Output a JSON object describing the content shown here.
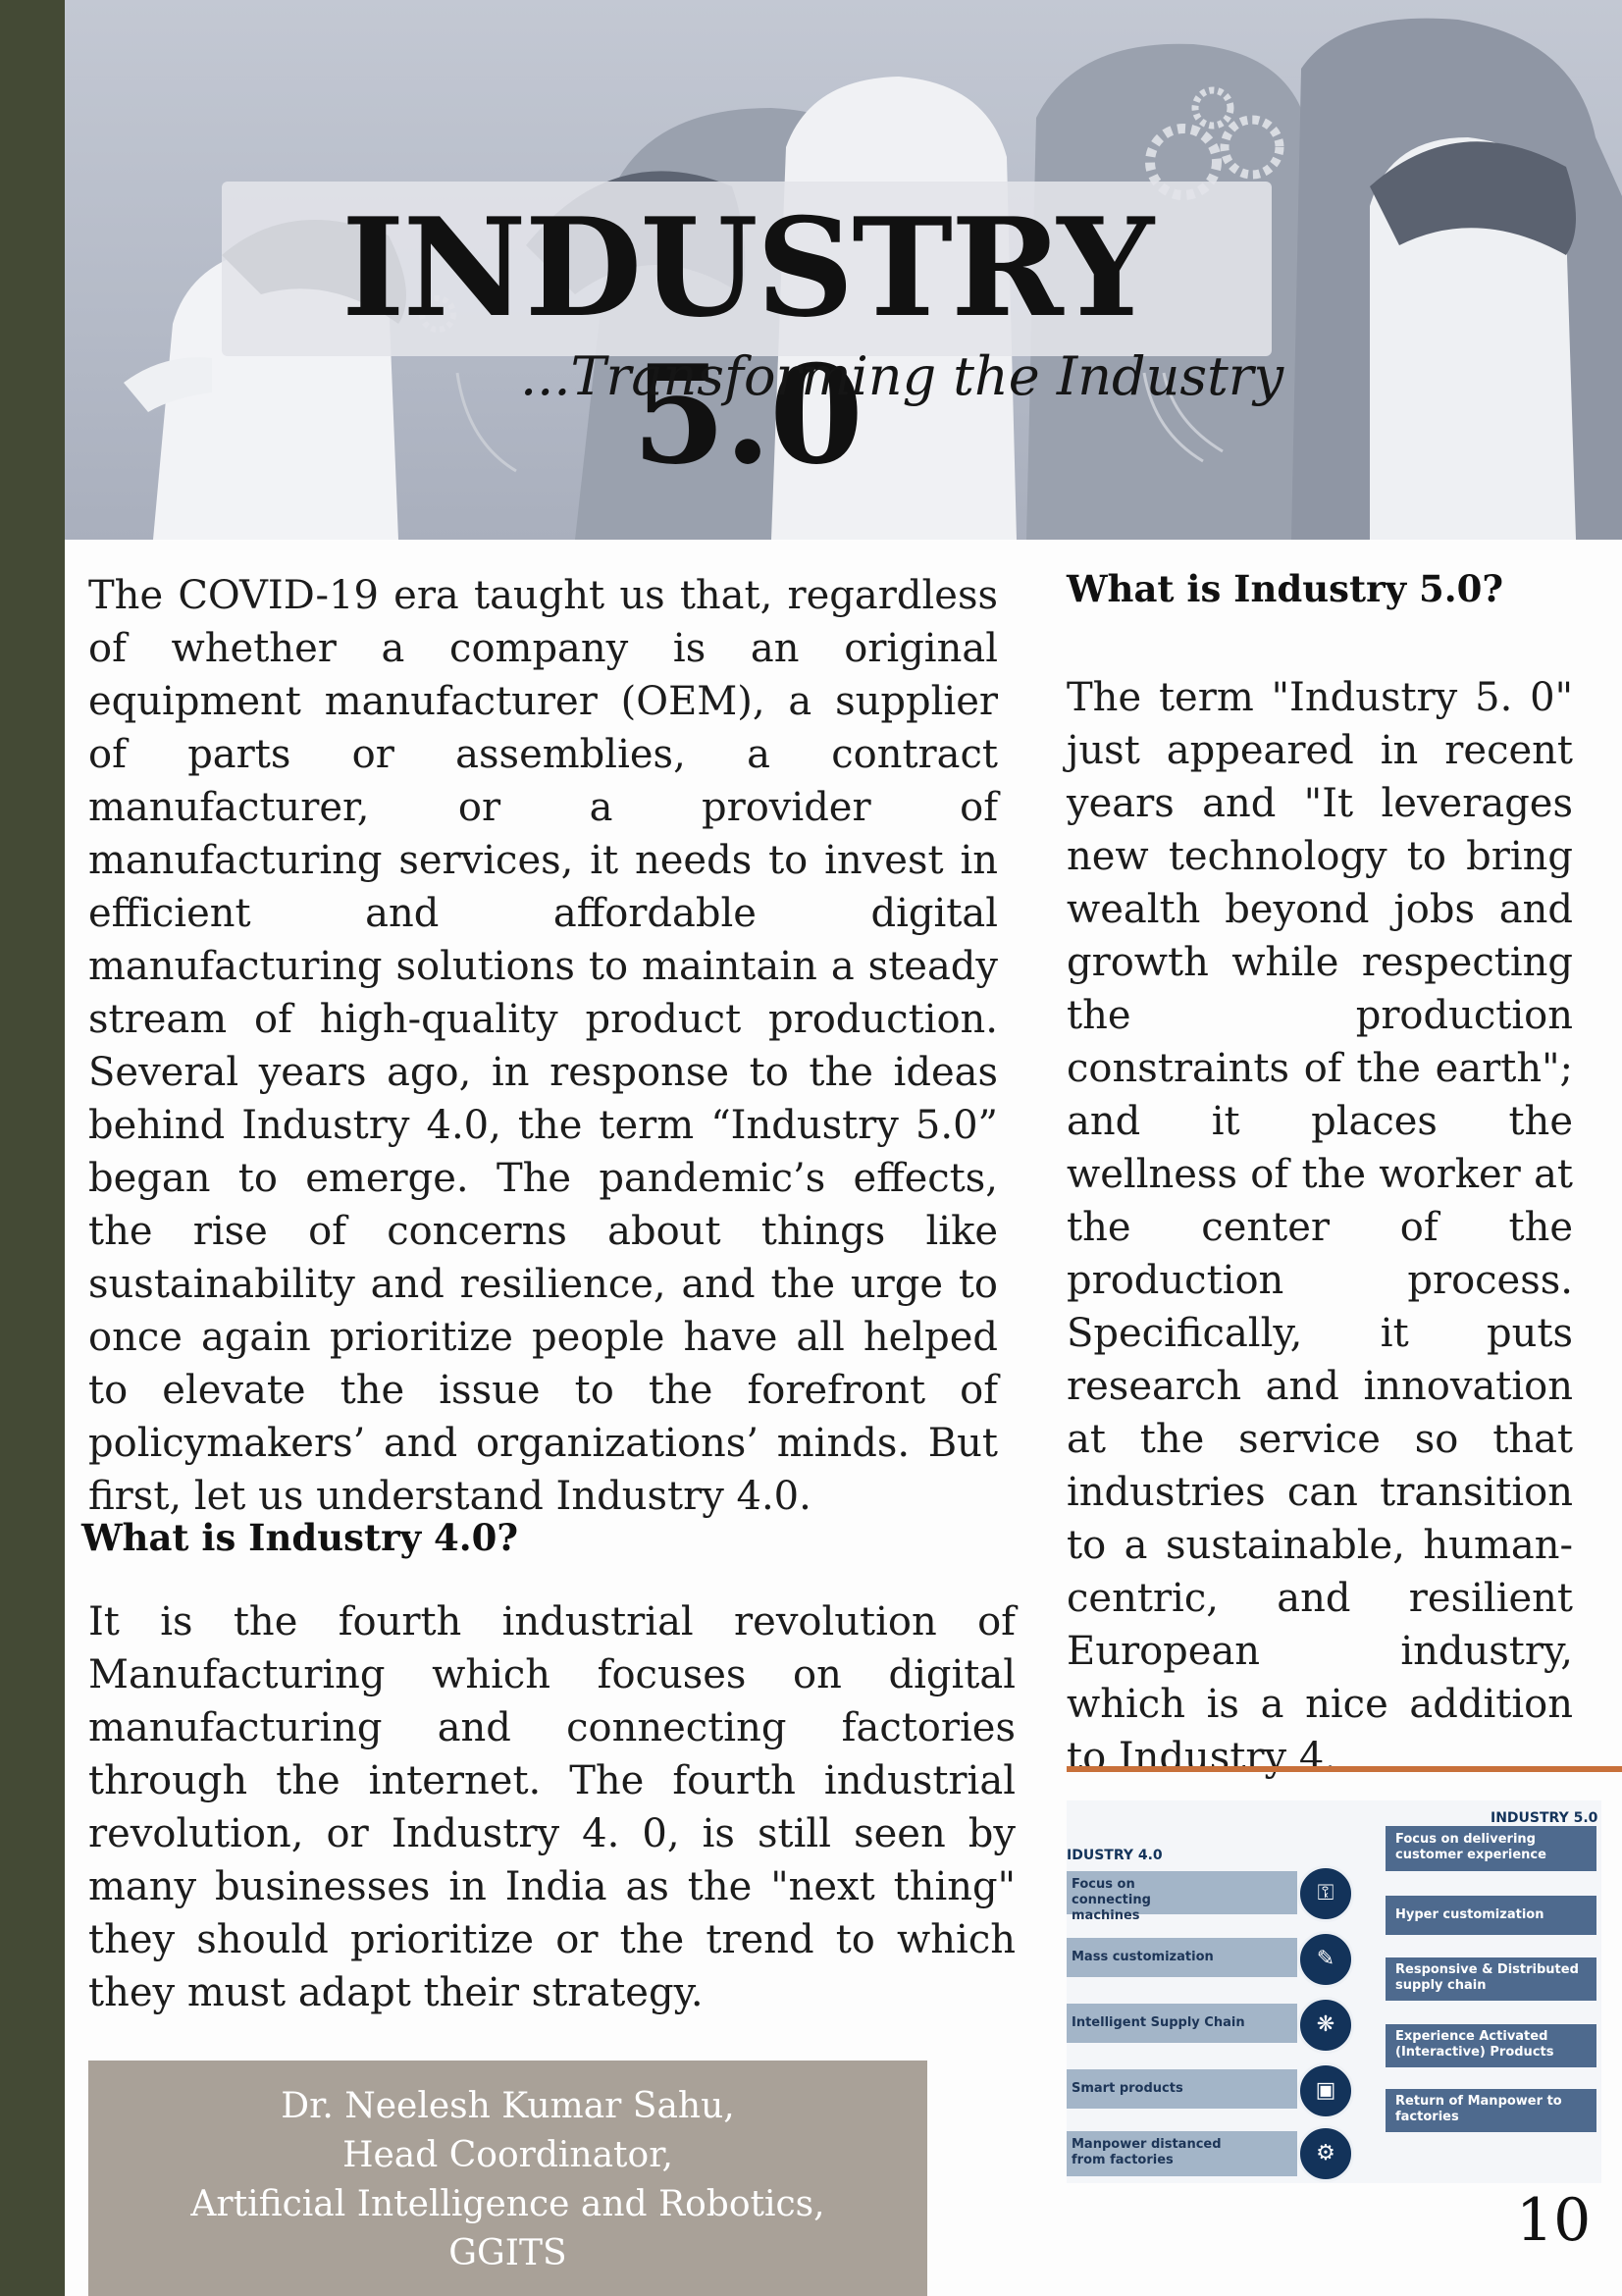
{
  "hero": {
    "title": "INDUSTRY 5.0",
    "subtitle": "...Transforming the Industry"
  },
  "intro": {
    "text": "The COVID-19 era taught us that, regardless of whether a company is an original equipment manufacturer (OEM), a supplier of parts or assemblies, a contract manufacturer, or a provider of manufacturing services, it needs to invest in efficient and affordable digital manufacturing solutions to maintain a steady stream of high-quality product production. Several years ago, in response to the ideas behind Industry 4.0, the term “Industry 5.0” began to emerge. The pandemic’s effects, the rise of concerns about things like sustainability and resilience, and the urge to once again prioritize people have all helped to elevate the issue to the forefront of policymakers’ and organizations’ minds. But first, let us understand Industry 4.0."
  },
  "section_40": {
    "heading": "What is Industry 4.0?",
    "text": "It is the fourth industrial revolution of Manufacturing which focuses on digital manufacturing and connecting factories through the internet. The fourth industrial revolution, or Industry 4. 0, is still seen by many businesses in India as the \"next thing\" they should prioritize or the trend to which they must adapt their strategy."
  },
  "section_50": {
    "heading": "What is Industry 5.0?",
    "text": "The term \"Industry 5. 0\" just appeared in recent years and \"It leverages new technology to bring wealth beyond jobs and growth while respecting the production constraints of the earth\"; and it places the wellness of the worker at the center of the production process. Specifically, it puts research and innovation at the service so that industries can transition to a sustainable, human-centric, and resilient European industry, which is a nice addition to Industry 4."
  },
  "author": {
    "name": "Dr. Neelesh Kumar Sahu,",
    "role": "Head Coordinator,",
    "dept": "Artificial Intelligence and Robotics,",
    "org": "GGITS"
  },
  "diagram": {
    "left_title": "IDUSTRY 4.0",
    "right_title": "INDUSTRY 5.0",
    "left_items": [
      "Focus on connecting machines",
      "Mass customization",
      "Intelligent Supply Chain",
      "Smart products",
      "Manpower distanced from factories"
    ],
    "right_items": [
      "Focus on delivering customer experience",
      "Hyper customization",
      "Responsive & Distributed supply chain",
      "Experience Activated (Interactive) Products",
      "Return of Manpower to factories"
    ],
    "icons": [
      "binoculars-icon",
      "wrench-icon",
      "network-icon",
      "package-icon",
      "worker-icon"
    ]
  },
  "page_number": "10",
  "colors": {
    "sidebar": "#444a35",
    "accent_rule": "#c8703a",
    "author_box": "#a9a198",
    "diagram_dark": "#13335a"
  }
}
